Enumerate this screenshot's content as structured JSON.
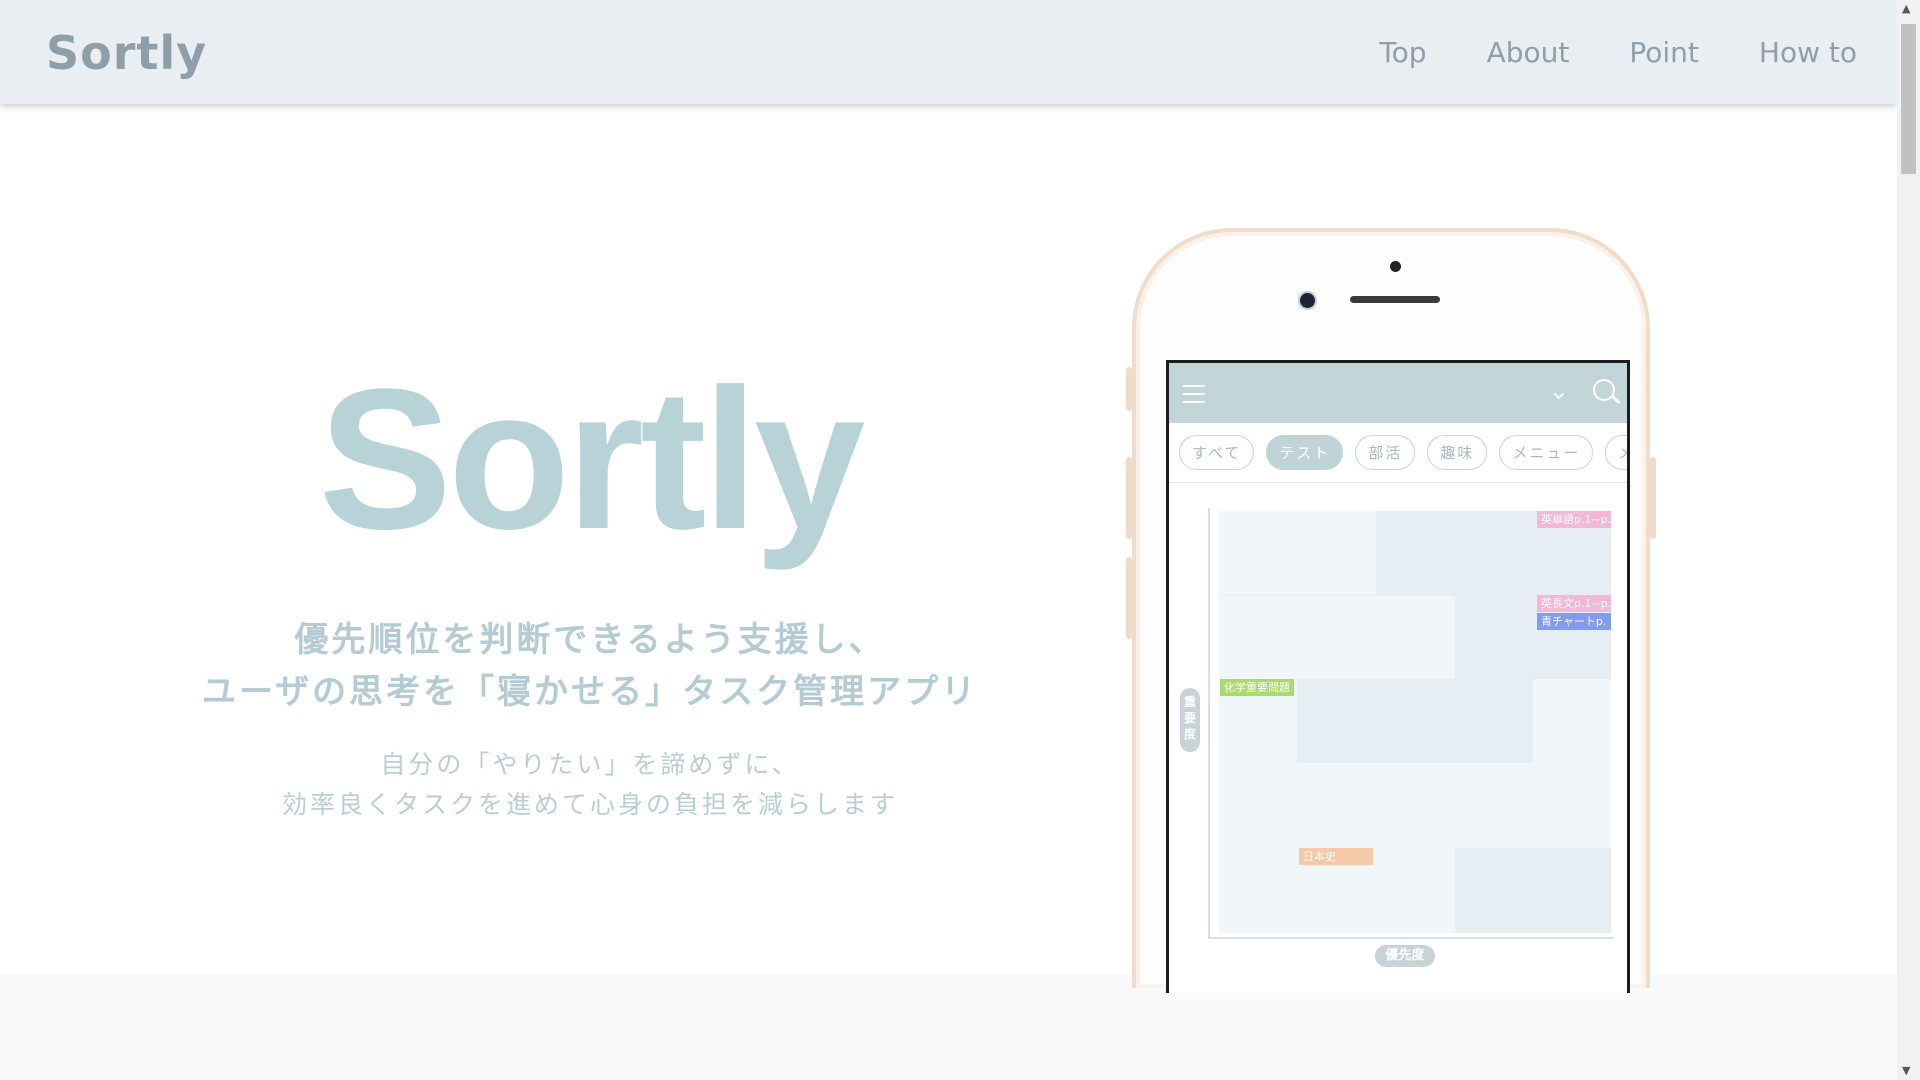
{
  "header": {
    "logo": "Sortly",
    "nav": [
      "Top",
      "About",
      "Point",
      "How to"
    ]
  },
  "hero": {
    "title": "Sortly",
    "tagline": [
      "優先順位を判断できるよう支援し、",
      "ユーザの思考を「寝かせる」タスク管理アプリ"
    ],
    "sub": [
      "自分の「やりたい」を諦めずに、",
      "効率良くタスクを進めて心身の負担を減らします"
    ]
  },
  "phone": {
    "chips": [
      "すべて",
      "テスト",
      "部活",
      "趣味",
      "メニュー",
      "メ"
    ],
    "active_chip": "テスト",
    "y_axis_label": "重要度",
    "x_axis_label": "優先度",
    "tasks": [
      {
        "label": "英単語p.1~p.",
        "color": "#f2b8d6"
      },
      {
        "label": "英長文p.1~p.",
        "color": "#f2b8d6"
      },
      {
        "label": "青チャートp.",
        "color": "#7f9cf0"
      },
      {
        "label": "化学重要問題",
        "color": "#a8dd6a"
      },
      {
        "label": "日本史",
        "color": "#f5c9a7"
      }
    ]
  },
  "colors": {
    "header_bg": "#e9eef2",
    "logo": "#8e9faa",
    "hero_title": "#b7d3d8",
    "app_bar": "#c2d6da"
  }
}
